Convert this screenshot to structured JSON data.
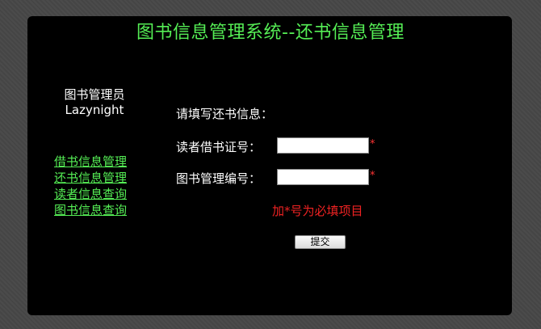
{
  "header": {
    "title": "图书信息管理系统--还书信息管理"
  },
  "user": {
    "role": "图书管理员",
    "name": "Lazynight"
  },
  "nav": {
    "items": [
      {
        "label": "借书信息管理"
      },
      {
        "label": "还书信息管理"
      },
      {
        "label": "读者信息查询"
      },
      {
        "label": "图书信息查询"
      }
    ]
  },
  "form": {
    "heading": "请填写还书信息：",
    "reader_card_label": "读者借书证号：",
    "reader_card_value": "",
    "book_id_label": "图书管理编号：",
    "book_id_value": "",
    "required_mark": "*",
    "hint": "加*号为必填项目",
    "submit_label": "提交"
  },
  "colors": {
    "title_green": "#55ee55",
    "required_red": "#ee2222",
    "panel_bg": "#000000",
    "page_bg": "#474747"
  }
}
